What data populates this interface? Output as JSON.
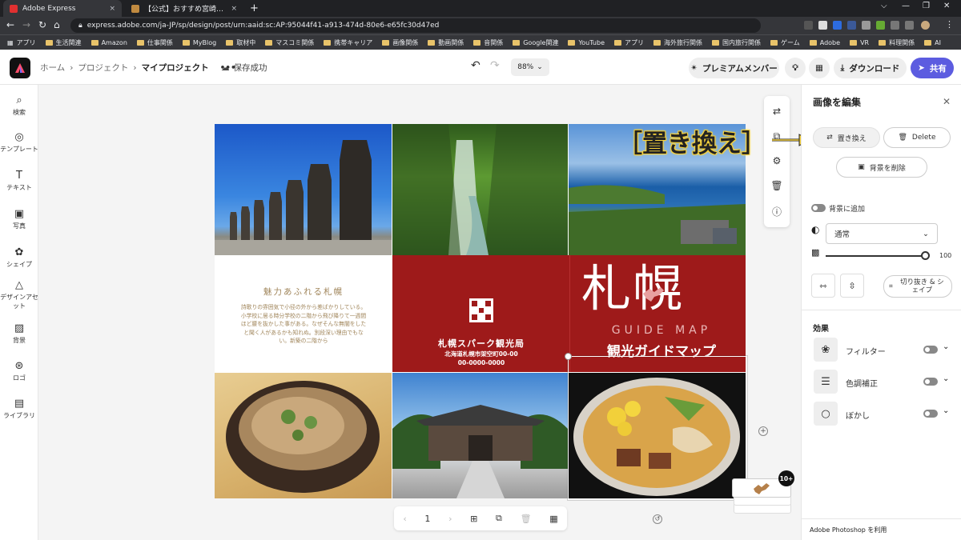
{
  "browser": {
    "tabs": [
      {
        "title": "Adobe Express",
        "close": "×",
        "color": "#e03030"
      },
      {
        "title": "【公式】おすすめ宮崎観光スポット／…",
        "close": "×",
        "color": "#c08a40"
      }
    ],
    "new_tab": "+",
    "window_controls": [
      "⌵",
      "—",
      "❐",
      "✕"
    ],
    "url": "express.adobe.com/ja-JP/sp/design/post/urn:aaid:sc:AP:95044f41-a913-474d-80e6-e65fc30d47ed",
    "bookmarks": [
      "アプリ",
      "生活関連",
      "Amazon",
      "仕事関係",
      "MyBlog",
      "取材中",
      "マスコミ関係",
      "携帯キャリア",
      "画像関係",
      "動画関係",
      "音関係",
      "Google関連",
      "YouTube",
      "アプリ",
      "海外旅行関係",
      "国内旅行関係",
      "ゲーム",
      "Adobe",
      "VR",
      "料理関係",
      "AI"
    ]
  },
  "header": {
    "breadcrumb": [
      "ホーム",
      "プロジェクト",
      "マイプロジェクト"
    ],
    "more": "•••",
    "save_status": "保存成功",
    "zoom": "88%",
    "premium_label": "プレミアムメンバー",
    "download_label": "ダウンロード",
    "share_label": "共有"
  },
  "rail": [
    {
      "label": "検索",
      "icon": "search-icon"
    },
    {
      "label": "テンプレート",
      "icon": "template-icon"
    },
    {
      "label": "テキスト",
      "icon": "text-icon"
    },
    {
      "label": "写真",
      "icon": "photo-icon"
    },
    {
      "label": "シェイプ",
      "icon": "shape-icon"
    },
    {
      "label": "デザインアセット",
      "icon": "design-assets-icon"
    },
    {
      "label": "背景",
      "icon": "background-icon"
    },
    {
      "label": "ロゴ",
      "icon": "logo-icon"
    },
    {
      "label": "ライブラリ",
      "icon": "library-icon"
    }
  ],
  "design": {
    "intro_title": "魅力あふれる札幌",
    "intro_body": "詩歌りの雰囲気で小径の外から差ばかりしている。小学校に居る時分学校の二階から飛び降りて一週間ほど腰を抜かした事がある。なぜそんな無闇をしたと聞く人があるかも知れぬ。別段深い理由でもない。新築の二階から",
    "org_name": "札幌スパーク観光局",
    "org_address": "北海道札幌市架空町00-00",
    "org_phone": "00-0000-0000",
    "title_kanji": "札幌",
    "guide_map": "GUIDE MAP",
    "guide_map_jp": "観光ガイドマップ",
    "brand_red": "#9e1a1a"
  },
  "pager": {
    "page": "1",
    "prev": "‹",
    "next": "›"
  },
  "page_count_badge": "10+",
  "annotation": "［置き換え］",
  "panel": {
    "title": "画像を編集",
    "replace_label": "置き換え",
    "delete_label": "Delete",
    "remove_bg_label": "背景を削除",
    "add_to_bg_label": "背景に追加",
    "blend_mode": "通常",
    "opacity_value": "100",
    "opacity_fraction": 1.0,
    "crop_label": "切り抜き & シェイプ",
    "effects_title": "効果",
    "effects": [
      {
        "label": "フィルター",
        "icon": "filter-icon"
      },
      {
        "label": "色調補正",
        "icon": "adjust-icon"
      },
      {
        "label": "ぼかし",
        "icon": "blur-icon"
      }
    ],
    "photoshop_note": "Adobe Photoshop を利用"
  },
  "colors": {
    "accent": "#5c5ce0",
    "brand_red": "#9e1a1a"
  }
}
